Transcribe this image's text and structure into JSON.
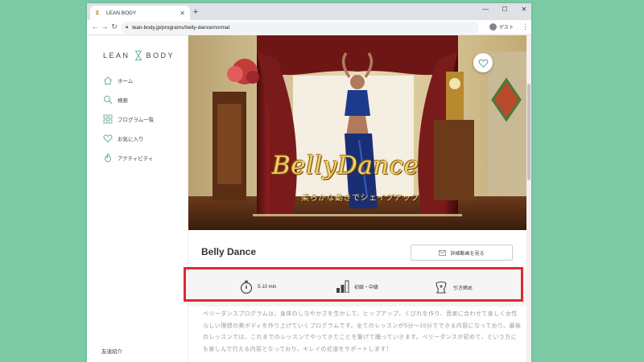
{
  "browser": {
    "tab_title": "LEAN BODY",
    "url": "lean-body.jp/programs/belly-dance/normal",
    "guest_label": "ゲスト"
  },
  "sidebar": {
    "logo_left": "LEAN",
    "logo_right": "BODY",
    "items": [
      {
        "label": "ホーム",
        "icon": "home-icon"
      },
      {
        "label": "検索",
        "icon": "search-icon"
      },
      {
        "label": "プログラム一覧",
        "icon": "grid-icon"
      },
      {
        "label": "お気に入り",
        "icon": "heart-icon"
      },
      {
        "label": "アクティビティ",
        "icon": "flame-icon"
      }
    ],
    "friend_label": "友達紹介"
  },
  "hero": {
    "title": "BellyDance",
    "subtitle": "柔らかな動きでシェイプアップ"
  },
  "program": {
    "title": "Belly Dance",
    "video_button": "詳細動画を見る",
    "stats": {
      "duration": "5-10 min",
      "level": "初級・中級",
      "effect": "引き締め"
    },
    "description": "ベリーダンスプログラムは、身体のしなやかさを生かして、ヒップアップ、くびれを作り、音楽に合わせて楽しく女性らしい理想の美ボディを作り上げていくプログラムです。全てのレッスンが5分〜10分でできる内容になっており、最後のレッスンでは、これまでのレッスンでやってきたことを繋げて踊っていきます。ベリーダンスが初めて、という方にも楽しんで行える内容となっており、キレイの近道をサポートします！"
  },
  "colors": {
    "background": "#7cc9a5",
    "highlight": "#e0282e",
    "accent": "#6ab0a0"
  }
}
